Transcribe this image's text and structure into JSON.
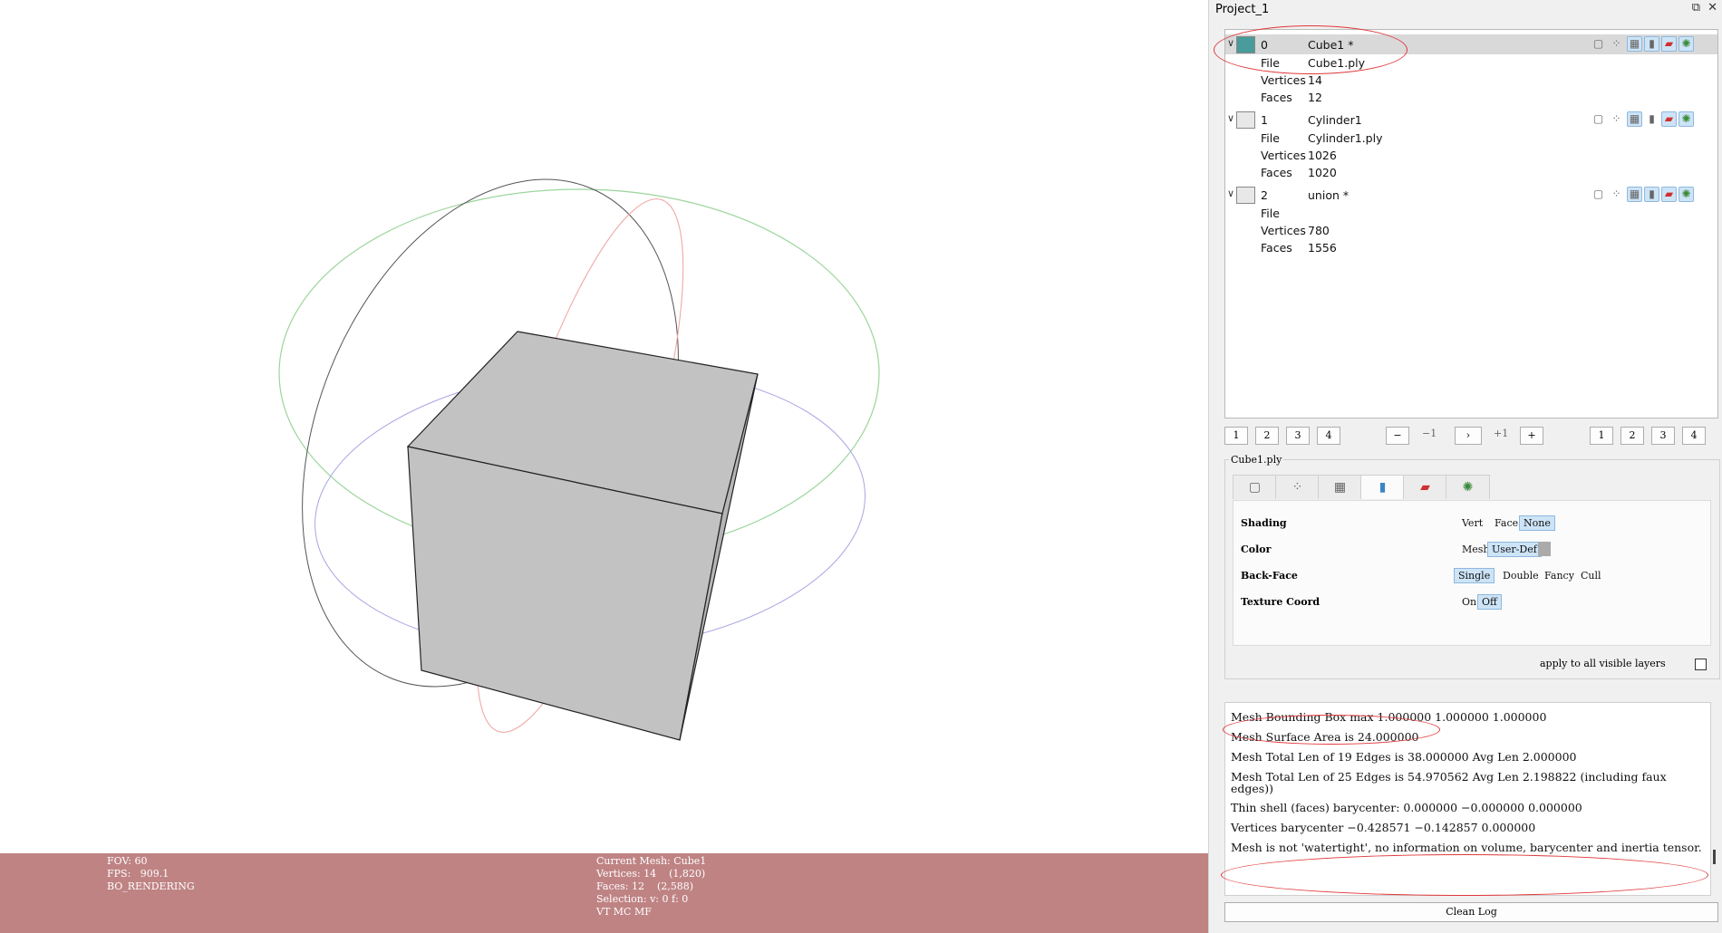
{
  "viewport": {
    "status_left": [
      "FOV: 60",
      "FPS:   909.1",
      "BO_RENDERING"
    ],
    "status_right": [
      "Current Mesh: Cube1",
      "Vertices: 14    (1,820)",
      "Faces: 12    (2,588)",
      "Selection: v: 0 f: 0",
      "VT MC MF"
    ]
  },
  "panel": {
    "title": "Project_1",
    "float_icon": "restore-icon",
    "close_icon": "close-icon",
    "layers": [
      {
        "id": "0",
        "name": "Cube1 *",
        "file_label": "File",
        "file": "Cube1.ply",
        "vertices_label": "Vertices",
        "vertices": "14",
        "faces_label": "Faces",
        "faces": "12",
        "selected": true
      },
      {
        "id": "1",
        "name": "Cylinder1",
        "file_label": "File",
        "file": "Cylinder1.ply",
        "vertices_label": "Vertices",
        "vertices": "1026",
        "faces_label": "Faces",
        "faces": "1020",
        "selected": false
      },
      {
        "id": "2",
        "name": "union *",
        "file_label": "File",
        "file": "",
        "vertices_label": "Vertices",
        "vertices": "780",
        "faces_label": "Faces",
        "faces": "1556",
        "selected": false
      }
    ],
    "pager": {
      "left": [
        "1",
        "2",
        "3",
        "4"
      ],
      "minus": "−",
      "minus_one": "−1",
      "play": "›",
      "plus_one": "+1",
      "plus": "+",
      "right": [
        "1",
        "2",
        "3",
        "4"
      ]
    },
    "decorator": {
      "title": "Cube1.ply",
      "tabs": [
        "box-icon",
        "points-icon",
        "wire-icon",
        "solid-icon",
        "texture-icon",
        "shading-icon"
      ],
      "shading_label": "Shading",
      "shading_options": [
        "Vert",
        "Face",
        "None"
      ],
      "color_label": "Color",
      "color_options": [
        "Mesh",
        "User-Def"
      ],
      "backface_label": "Back-Face",
      "backface_options": [
        "Single",
        "Double",
        "Fancy",
        "Cull"
      ],
      "texcoord_label": "Texture Coord",
      "texcoord_options": [
        "On",
        "Off"
      ],
      "apply_label": "apply to all visible layers"
    },
    "log": [
      "Mesh Bounding Box max 1.000000 1.000000 1.000000",
      "Mesh Surface Area is 24.000000",
      "Mesh Total Len of 19 Edges is 38.000000 Avg Len 2.000000",
      "Mesh Total Len of 25 Edges is 54.970562 Avg Len 2.198822 (including faux edges))",
      "Thin shell (faces) barycenter: 0.000000 −0.000000 0.000000",
      "Vertices barycenter −0.428571 −0.142857 0.000000",
      "Mesh is not 'watertight', no information on volume, barycenter and inertia tensor."
    ],
    "clean_log": "Clean Log"
  }
}
